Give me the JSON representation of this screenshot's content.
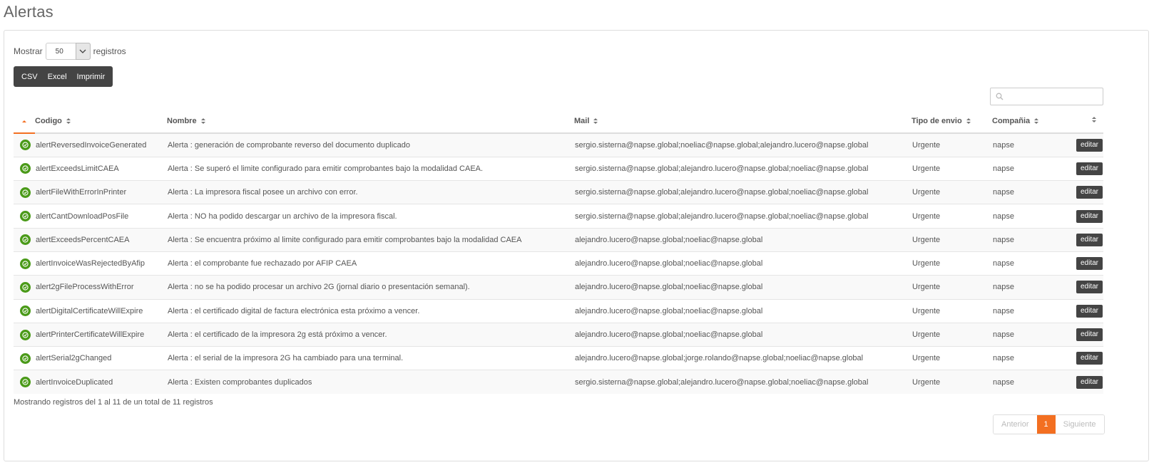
{
  "page": {
    "title": "Alertas"
  },
  "length": {
    "prefix": "Mostrar",
    "value": "50",
    "suffix": "registros"
  },
  "export_buttons": {
    "csv": "CSV",
    "excel": "Excel",
    "print": "Imprimir"
  },
  "search": {
    "placeholder": ""
  },
  "table": {
    "headers": {
      "code": "Codigo",
      "name": "Nombre",
      "mail": "Mail",
      "send_type": "Tipo de envio",
      "company": "Compañia"
    },
    "rows": [
      {
        "code": "alertReversedInvoiceGenerated",
        "name": "Alerta : generación de comprobante reverso del documento duplicado",
        "mail": "sergio.sisterna@napse.global;noeliac@napse.global;alejandro.lucero@napse.global",
        "send_type": "Urgente",
        "company": "napse",
        "action": "editar"
      },
      {
        "code": "alertExceedsLimitCAEA",
        "name": "Alerta : Se superó el limite configurado para emitir comprobantes bajo la modalidad CAEA.",
        "mail": "sergio.sisterna@napse.global;alejandro.lucero@napse.global;noeliac@napse.global",
        "send_type": "Urgente",
        "company": "napse",
        "action": "editar"
      },
      {
        "code": "alertFileWithErrorInPrinter",
        "name": "Alerta : La impresora fiscal posee un archivo con error.",
        "mail": "sergio.sisterna@napse.global;alejandro.lucero@napse.global;noeliac@napse.global",
        "send_type": "Urgente",
        "company": "napse",
        "action": "editar"
      },
      {
        "code": "alertCantDownloadPosFile",
        "name": "Alerta : NO ha podido descargar un archivo de la impresora fiscal.",
        "mail": "sergio.sisterna@napse.global;alejandro.lucero@napse.global;noeliac@napse.global",
        "send_type": "Urgente",
        "company": "napse",
        "action": "editar"
      },
      {
        "code": "alertExceedsPercentCAEA",
        "name": "Alerta : Se encuentra próximo al limite configurado para emitir comprobantes bajo la modalidad CAEA",
        "mail": "alejandro.lucero@napse.global;noeliac@napse.global",
        "send_type": "Urgente",
        "company": "napse",
        "action": "editar"
      },
      {
        "code": "alertInvoiceWasRejectedByAfip",
        "name": "Alerta : el comprobante fue rechazado por AFIP CAEA",
        "mail": "alejandro.lucero@napse.global;noeliac@napse.global",
        "send_type": "Urgente",
        "company": "napse",
        "action": "editar"
      },
      {
        "code": "alert2gFileProcessWithError",
        "name": "Alerta : no se ha podido procesar un archivo 2G (jornal diario o presentación semanal).",
        "mail": "alejandro.lucero@napse.global;noeliac@napse.global",
        "send_type": "Urgente",
        "company": "napse",
        "action": "editar"
      },
      {
        "code": "alertDigitalCertificateWillExpire",
        "name": "Alerta : el certificado digital de factura electrónica esta próximo a vencer.",
        "mail": "alejandro.lucero@napse.global;noeliac@napse.global",
        "send_type": "Urgente",
        "company": "napse",
        "action": "editar"
      },
      {
        "code": "alertPrinterCertificateWillExpire",
        "name": "Alerta : el certificado de la impresora 2g está próximo a vencer.",
        "mail": "alejandro.lucero@napse.global;noeliac@napse.global",
        "send_type": "Urgente",
        "company": "napse",
        "action": "editar"
      },
      {
        "code": "alertSerial2gChanged",
        "name": "Alerta : el serial de la impresora 2G ha cambiado para una terminal.",
        "mail": "alejandro.lucero@napse.global;jorge.rolando@napse.global;noeliac@napse.global",
        "send_type": "Urgente",
        "company": "napse",
        "action": "editar"
      },
      {
        "code": "alertInvoiceDuplicated",
        "name": "Alerta : Existen comprobantes duplicados",
        "mail": "sergio.sisterna@napse.global;alejandro.lucero@napse.global;noeliac@napse.global",
        "send_type": "Urgente",
        "company": "napse",
        "action": "editar"
      }
    ]
  },
  "info": "Mostrando registros del 1 al 11 de un total de 11 registros",
  "pagination": {
    "prev": "Anterior",
    "current": "1",
    "next": "Siguiente"
  },
  "colors": {
    "accent": "#f36f21",
    "status_ok": "#4a9a18",
    "dark_button": "#444444"
  },
  "icons": {
    "status": "check-circle-icon",
    "search": "search-icon",
    "select_caret": "chevron-down-icon",
    "sort": "sort-icon"
  }
}
